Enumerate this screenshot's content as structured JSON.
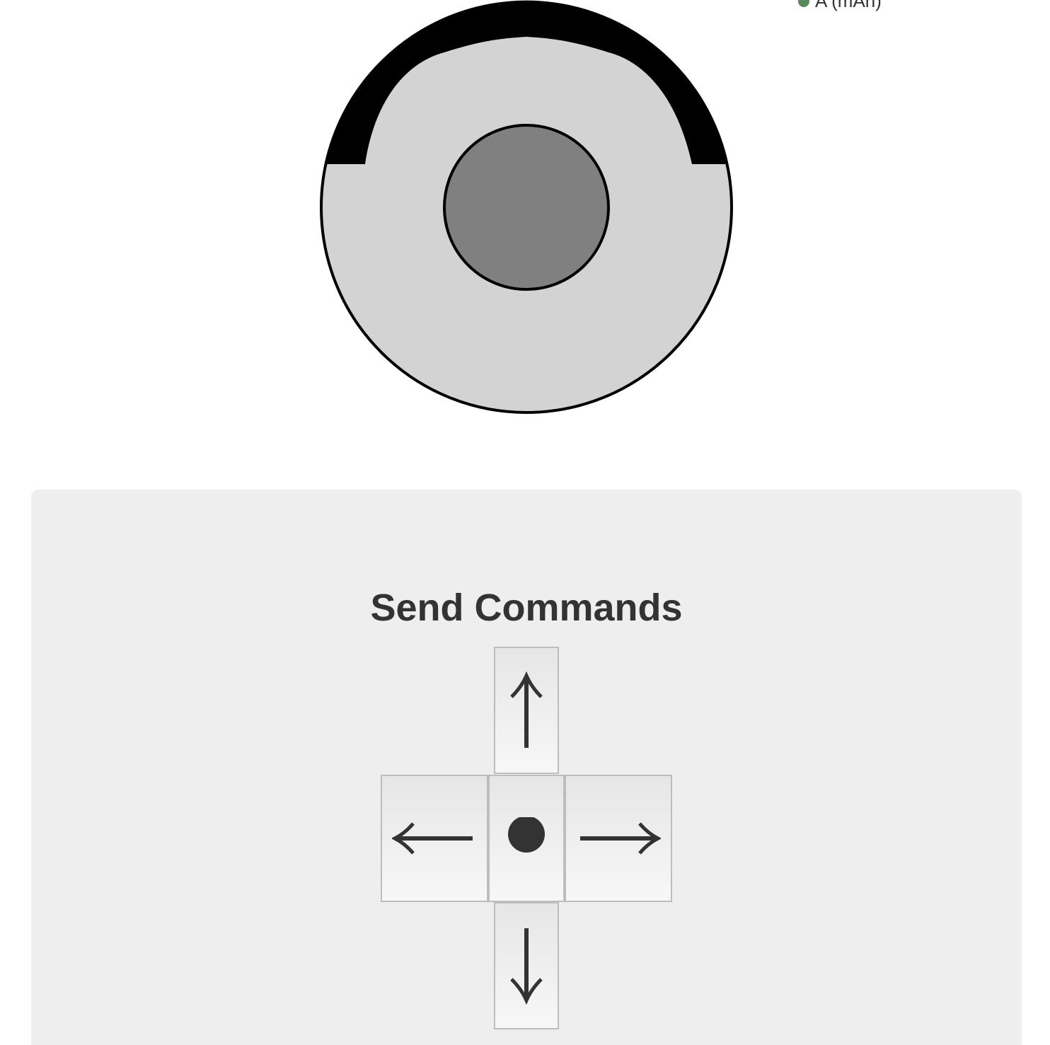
{
  "header": {
    "status_label": "A (mAh)"
  },
  "robot": {
    "body_color": "#d3d3d3",
    "bumper_color": "#000000",
    "center_color": "#808080"
  },
  "commands": {
    "title": "Send Commands",
    "buttons": {
      "up": "forward-arrow-icon",
      "left": "left-arrow-icon",
      "stop": "stop-dot-icon",
      "right": "right-arrow-icon",
      "down": "backward-arrow-icon"
    }
  }
}
